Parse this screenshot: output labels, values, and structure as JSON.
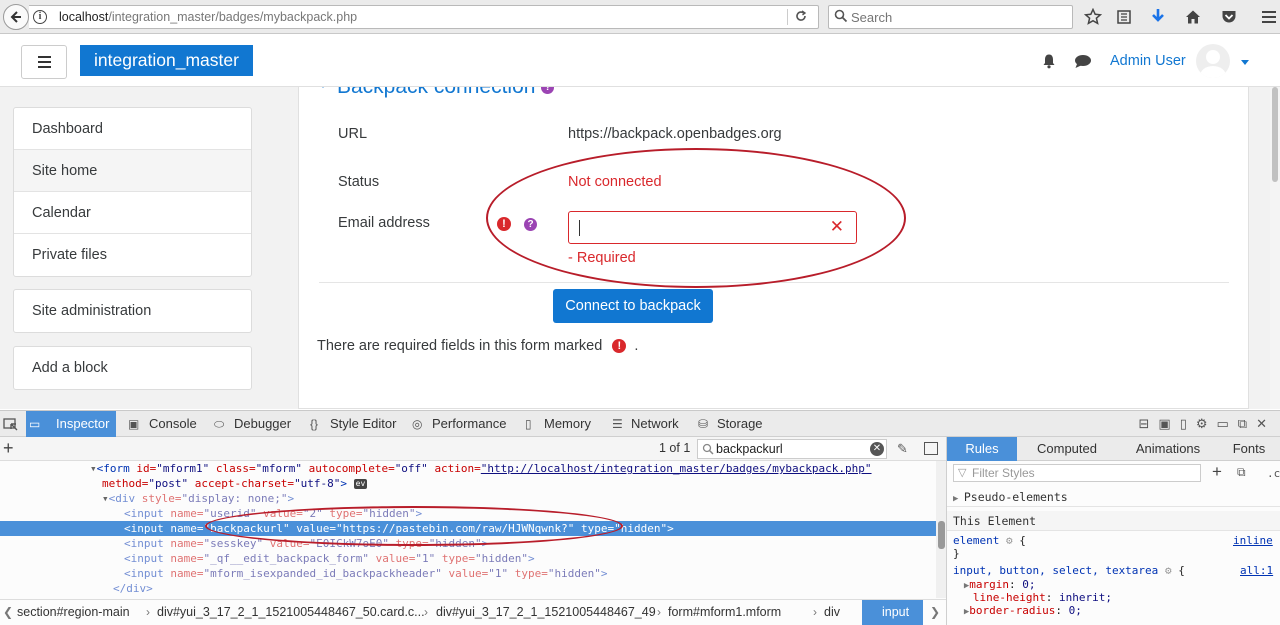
{
  "browser": {
    "url_host": "localhost",
    "url_path": "/integration_master/badges/mybackpack.php",
    "search_placeholder": "Search"
  },
  "navbar": {
    "brand": "integration_master",
    "user_name": "Admin User"
  },
  "sidebar": {
    "nav_items": [
      {
        "label": "Dashboard"
      },
      {
        "label": "Site home"
      },
      {
        "label": "Calendar"
      },
      {
        "label": "Private files"
      }
    ],
    "admin_item": "Site administration",
    "add_block": "Add a block"
  },
  "form": {
    "section_title": "Backpack connection",
    "url_label": "URL",
    "url_value": "https://backpack.openbadges.org",
    "status_label": "Status",
    "status_value": "Not connected",
    "email_label": "Email address",
    "email_value": "",
    "email_error": "- Required",
    "connect_button": "Connect to backpack",
    "required_note": "There are required fields in this form marked",
    "required_note_end": "."
  },
  "devtools": {
    "tabs": [
      {
        "label": "Inspector",
        "icon": "inspector-icon"
      },
      {
        "label": "Console",
        "icon": "console-icon"
      },
      {
        "label": "Debugger",
        "icon": "debugger-icon"
      },
      {
        "label": "Style Editor",
        "icon": "style-editor-icon"
      },
      {
        "label": "Performance",
        "icon": "performance-icon"
      },
      {
        "label": "Memory",
        "icon": "memory-icon"
      },
      {
        "label": "Network",
        "icon": "network-icon"
      },
      {
        "label": "Storage",
        "icon": "storage-icon"
      }
    ],
    "match_count": "1 of 1",
    "search_value": "backpackurl",
    "markup_lines": {
      "l1": {
        "a": "<form ",
        "b": "id=",
        "c": "\"mform1\" ",
        "d": "class=",
        "e": "\"mform\" ",
        "f": "autocomplete=",
        "g": "\"off\" ",
        "h": "action=",
        "i": "\"http://localhost/integration_master/badges/mybackpack.php\"",
        "j": ""
      },
      "l2": {
        "a": "method=",
        "b": "\"post\" ",
        "c": "accept-charset=",
        "d": "\"utf-8\"",
        "e": ">",
        "ev": "ev"
      },
      "l3": {
        "a": "<div ",
        "b": "style=",
        "c": "\"display: none;\"",
        "d": ">"
      },
      "l4": {
        "a": "<input ",
        "b": "name=",
        "c": "\"userid\" ",
        "d": "value=",
        "e": "\"2\" ",
        "f": "type=",
        "g": "\"hidden\"",
        "h": ">"
      },
      "l5": {
        "a": "<input ",
        "b": "name=",
        "c": "\"backpackurl\" ",
        "d": "value=",
        "e": "\"https://pastebin.com/raw/HJWNqwnk?\" ",
        "f": "type=",
        "g": "\"hidden\"",
        "h": ">"
      },
      "l6": {
        "a": "<input ",
        "b": "name=",
        "c": "\"sesskey\" ",
        "d": "value=",
        "e": "\"E0ICkW7oE0\" ",
        "f": "type=",
        "g": "\"hidden\"",
        "h": ">"
      },
      "l7": {
        "a": "<input ",
        "b": "name=",
        "c": "\"_qf__edit_backpack_form\" ",
        "d": "value=",
        "e": "\"1\" ",
        "f": "type=",
        "g": "\"hidden\"",
        "h": ">"
      },
      "l8": {
        "a": "<input ",
        "b": "name=",
        "c": "\"mform_isexpanded_id_backpackheader\" ",
        "d": "value=",
        "e": "\"1\" ",
        "f": "type=",
        "g": "\"hidden\"",
        "h": ">"
      },
      "l9": {
        "a": "</div>"
      }
    },
    "breadcrumbs": [
      "section#region-main",
      "div#yui_3_17_2_1_1521005448467_50.card.c...",
      "div#yui_3_17_2_1_1521005448467_49",
      "form#mform1.mform",
      "div",
      "input"
    ],
    "rules_tabs": [
      "Rules",
      "Computed",
      "Animations",
      "Fonts"
    ],
    "filter_placeholder": "Filter Styles",
    "cls_label": ".cls",
    "pseudo_elements": "Pseudo-elements",
    "this_element": "This Element",
    "rule1": {
      "selector": "element",
      "open": "{",
      "close": "}",
      "source": "inline"
    },
    "rule2": {
      "selector": "input, button, select, textarea",
      "open": "{",
      "source": "all:1",
      "props": [
        {
          "name": "margin",
          "value": "0;"
        },
        {
          "name": "line-height",
          "value": "inherit;"
        },
        {
          "name": "border-radius",
          "value": "0;"
        }
      ]
    }
  }
}
